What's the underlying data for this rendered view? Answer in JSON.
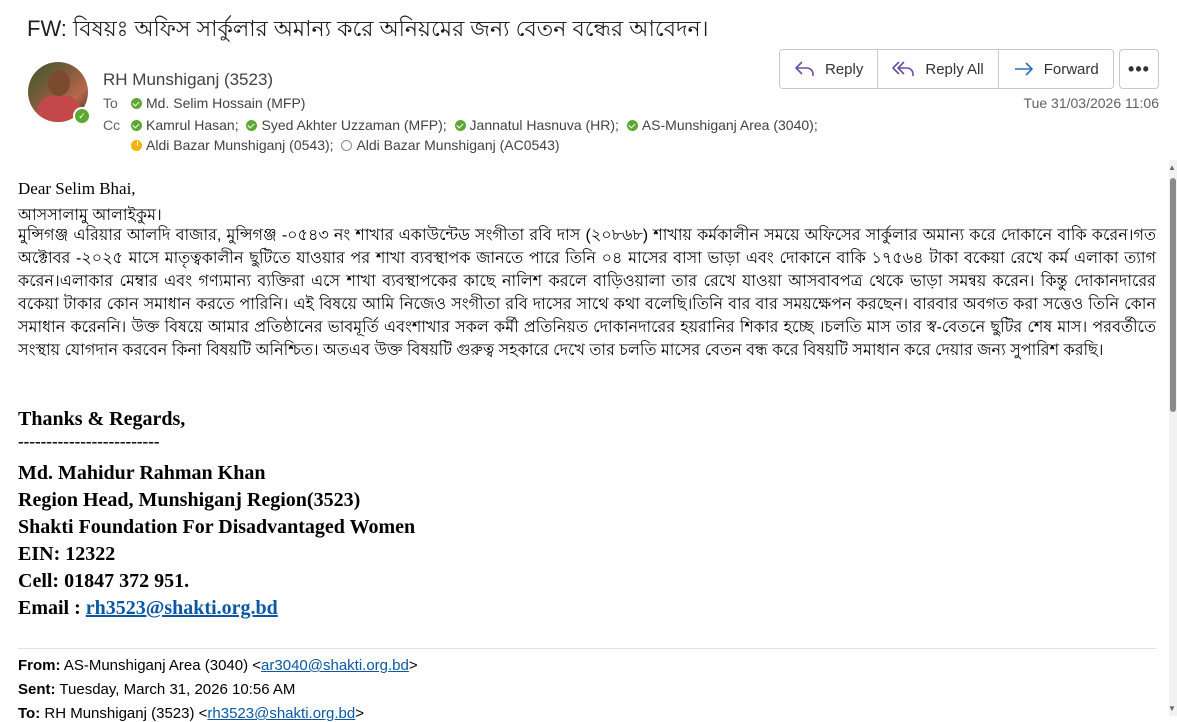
{
  "subject": "FW: বিষয়ঃ অফিস সার্কুলার অমান্য করে অনিয়মের জন্য বেতন বন্ধের আবেদন।",
  "header": {
    "sender": "RH Munshiganj (3523)",
    "to_label": "To",
    "cc_label": "Cc",
    "to": "Md. Selim Hossain (MFP)",
    "cc_line1": [
      "Kamrul Hasan;",
      "Syed Akhter Uzzaman (MFP);",
      "Jannatul Hasnuva (HR);",
      "AS-Munshiganj Area (3040);"
    ],
    "cc_line2": [
      "Aldi Bazar Munshiganj (0543);",
      "Aldi Bazar Munshiganj (AC0543)"
    ],
    "date": "Tue 31/03/2026 11:06"
  },
  "toolbar": {
    "reply": "Reply",
    "reply_all": "Reply All",
    "forward": "Forward",
    "more": "•••"
  },
  "body": {
    "greeting": "Dear Selim Bhai,",
    "salam": "আসসালামু আলাইকুম।",
    "paragraph": "মুন্সিগঞ্জ এরিয়ার  আলদি বাজার, মুন্সিগঞ্জ -০৫৪৩ নং শাখার  একাউন্টেড সংগীতা রবি দাস (২০৮৬৮) শাখায় কর্মকালীন সময়ে অফিসের সার্কুলার অমান্য করে দোকানে বাকি করেন।গত অক্টোবর -২০২৫ মাসে মাতৃত্বকালীন ছুটিতে যাওয়ার পর শাখা ব্যবস্থাপক জানতে  পারে তিনি ০৪ মাসের বাসা ভাড়া এবং দোকানে বাকি ১৭৫৬৪ টাকা বকেয়া রেখে কর্ম এলাকা ত্যাগ করেন।এলাকার মেম্বার এবং গণ্যমান্য ব্যক্তিরা এসে শাখা ব্যবস্থাপকের  কাছে নালিশ করলে বাড়িওয়ালা তার রেখে যাওয়া আসবাবপত্র থেকে ভাড়া সমন্বয় করেন। কিন্তু দোকানদারের বকেয়া টাকার কোন সমাধান করতে পারিনি। এই বিষয়ে আমি নিজেও সংগীতা রবি দাসের সাথে কথা বলেছি।তিনি বার বার সময়ক্ষেপন করছেন। বারবার অবগত করা সত্তেও তিনি কোন সমাধান করেননি। উক্ত বিষয়ে আমার প্রতিষ্ঠানের ভাবমূর্তি এবংশাখার সকল কর্মী  প্রতিনিয়ত  দোকানদারের হয়রানির শিকার হচ্ছে ।চলতি মাস তার স্ব-বেতনে ছুটির শেষ মাস। পরবর্তীতে সংস্থায় যোগদান করবেন কিনা বিষয়টি অনিশ্চিত। অতএব উক্ত বিষয়টি গুরুত্ব সহকারে দেখে তার চলতি মাসের বেতন বন্ধ করে বিষয়টি সমাধান করে দেয়ার জন্য সুপারিশ  করছি।"
  },
  "signature": {
    "thanks": "Thanks & Regards,",
    "divider": "-------------------------",
    "name": "Md. Mahidur Rahman Khan",
    "title": "Region Head, Munshiganj Region(3523)",
    "org": "Shakti Foundation For Disadvantaged Women",
    "ein": "EIN: 12322",
    "cell": "Cell: 01847 372 951.",
    "email_label": "Email : ",
    "email": "rh3523@shakti.org.bd"
  },
  "forwarded": {
    "from_label": "From:",
    "from_name": "AS-Munshiganj Area (3040) <",
    "from_email": "ar3040@shakti.org.bd",
    "from_close": ">",
    "sent_label": "Sent:",
    "sent_value": "Tuesday, March 31, 2026 10:56 AM",
    "to_label": "To:",
    "to_name": "RH Munshiganj (3523) <",
    "to_email": "rh3523@shakti.org.bd",
    "to_close": ">"
  },
  "colors": {
    "accent": "#0b57a3",
    "presence_available": "#5da832",
    "presence_away": "#f4b400"
  }
}
